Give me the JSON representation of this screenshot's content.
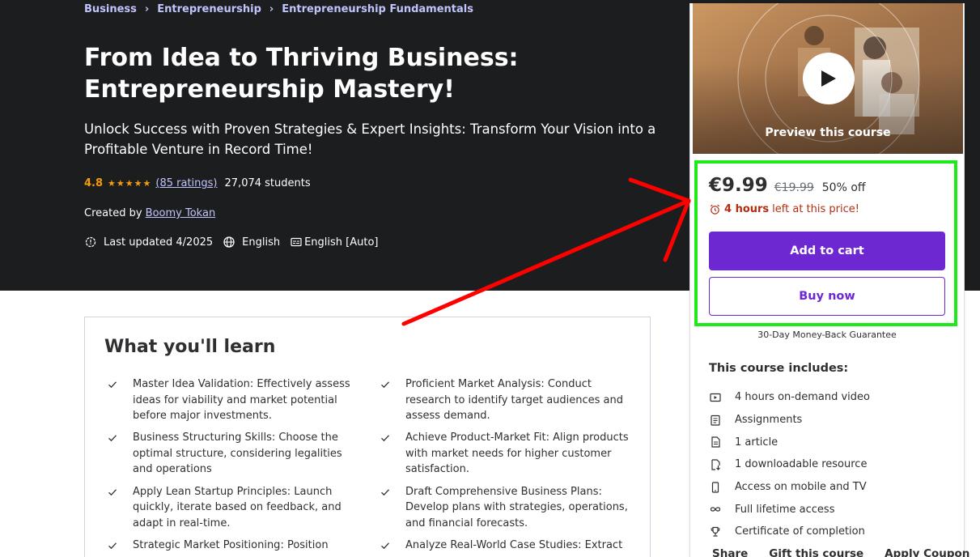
{
  "breadcrumb": [
    "Business",
    "Entrepreneurship",
    "Entrepreneurship Fundamentals"
  ],
  "course": {
    "title": "From Idea to Thriving Business: Entrepreneurship Mastery!",
    "subtitle": "Unlock Success with Proven Strategies & Expert Insights: Transform Your Vision into a Profitable Venture in Record Time!",
    "rating": "4.8",
    "rating_stars": 4.8,
    "ratings_count": "(85 ratings)",
    "students": "27,074 students",
    "created_by_label": "Created by",
    "instructor": "Boomy Tokan",
    "last_updated": "Last updated 4/2025",
    "language": "English",
    "captions": "English [Auto]"
  },
  "sidebar": {
    "preview_label": "Preview this course",
    "price": "€9.99",
    "original_price": "€19.99",
    "discount": "50% off",
    "timer_hours": "4 hours",
    "timer_rest": "left at this price!",
    "add_to_cart": "Add to cart",
    "buy_now": "Buy now",
    "guarantee": "30-Day Money-Back Guarantee",
    "includes_title": "This course includes:",
    "includes": [
      {
        "icon": "video-icon",
        "text": "4 hours on-demand video"
      },
      {
        "icon": "assignment-icon",
        "text": "Assignments"
      },
      {
        "icon": "article-icon",
        "text": "1 article"
      },
      {
        "icon": "download-icon",
        "text": "1 downloadable resource"
      },
      {
        "icon": "mobile-icon",
        "text": "Access on mobile and TV"
      },
      {
        "icon": "infinity-icon",
        "text": "Full lifetime access"
      },
      {
        "icon": "trophy-icon",
        "text": "Certificate of completion"
      }
    ],
    "share": "Share",
    "gift": "Gift this course",
    "coupon": "Apply Coupon"
  },
  "learn": {
    "title": "What you'll learn",
    "items": [
      "Master Idea Validation: Effectively assess ideas for viability and market potential before major investments.",
      "Proficient Market Analysis: Conduct research to identify target audiences and assess demand.",
      "Business Structuring Skills: Choose the optimal structure, considering legalities and operations",
      "Achieve Product-Market Fit: Align products with market needs for higher customer satisfaction.",
      "Apply Lean Startup Principles: Launch quickly, iterate based on feedback, and adapt in real-time.",
      "Draft Comprehensive Business Plans: Develop plans with strategies, operations, and financial forecasts.",
      "Strategic Market Positioning: Position",
      "Analyze Real-World Case Studies: Extract"
    ]
  },
  "colors": {
    "hero_bg": "#1c1d1f",
    "accent_purple": "#6d28d2",
    "link_lavender": "#c0c4fc",
    "star_orange": "#f69c08",
    "timer_red": "#b32d0f",
    "highlight_green": "#1eea19",
    "annotation_red": "#ff0000"
  }
}
